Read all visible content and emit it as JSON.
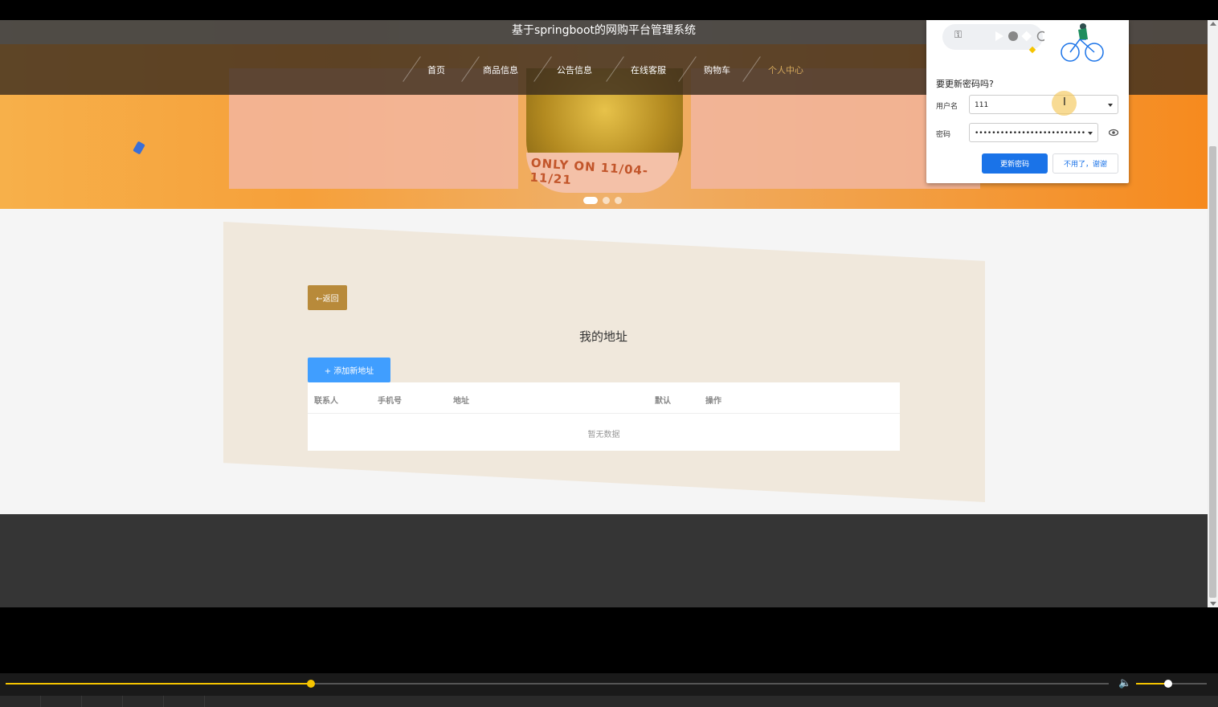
{
  "site": {
    "title": "基于springboot的网购平台管理系统"
  },
  "nav": {
    "items": [
      {
        "label": "首页",
        "active": false
      },
      {
        "label": "商品信息",
        "active": false
      },
      {
        "label": "公告信息",
        "active": false
      },
      {
        "label": "在线客服",
        "active": false
      },
      {
        "label": "购物车",
        "active": false
      },
      {
        "label": "个人中心",
        "active": true
      }
    ]
  },
  "banner": {
    "promo_text": "ONLY ON 11/04-11/21",
    "slide_count": 3,
    "active_slide": 1
  },
  "main": {
    "back_label": "←返回",
    "title": "我的地址",
    "add_label": "+ 添加新地址",
    "table": {
      "columns": [
        "联系人",
        "手机号",
        "地址",
        "默认",
        "操作"
      ],
      "rows": [],
      "empty_text": "暂无数据"
    }
  },
  "password_prompt": {
    "question": "要更新密码吗?",
    "username_label": "用户名",
    "username_value": "111",
    "password_label": "密码",
    "password_value": "••••••••••••••••••••••••••",
    "update_label": "更新密码",
    "cancel_label": "不用了，谢谢",
    "icons": [
      "key-icon",
      "eye-icon",
      "cyclist-illustration"
    ]
  },
  "player": {
    "progress": 0.277,
    "volume": 0.45,
    "icons": [
      "volume-icon"
    ]
  },
  "colors": {
    "accent": "#b88a3a",
    "primary_button": "#409eff",
    "chrome_blue": "#1a73e8",
    "seek": "#f5c400"
  }
}
